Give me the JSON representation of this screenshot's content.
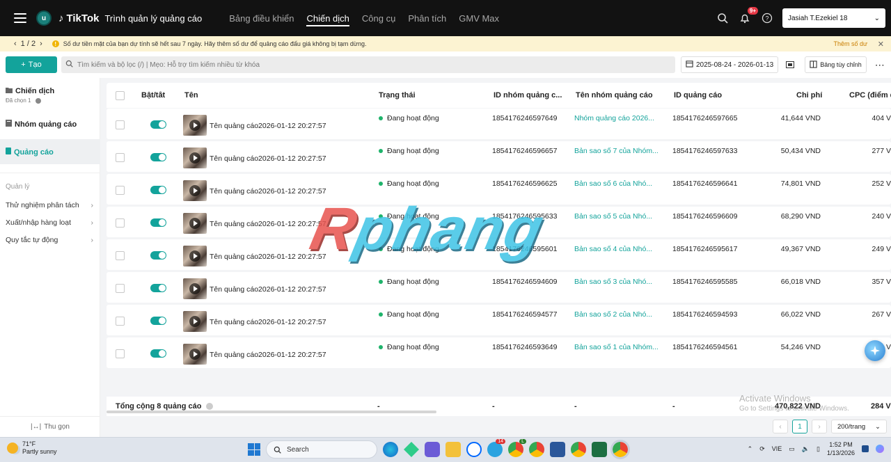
{
  "topbar": {
    "brand": "TikTok",
    "subtitle": "Trình quản lý quảng cáo",
    "avatar_letter": "u",
    "nav": [
      "Bảng điều khiển",
      "Chiến dịch",
      "Công cụ",
      "Phân tích",
      "GMV Max"
    ],
    "active_nav": "Chiến dịch",
    "notif_count": "9+",
    "account_name": "Jasiah T.Ezekiel 18"
  },
  "notice": {
    "pager": "1 / 2",
    "message": "Số dư tiền mặt của bạn dự tính sẽ hết sau 7 ngày. Hãy thêm số dư để quảng cáo đấu giá không bị tạm dừng.",
    "cta": "Thêm số dư"
  },
  "toolbar": {
    "create_label": "Tạo",
    "search_placeholder": "Tìm kiếm và bộ lọc (/) | Mẹo: Hỗ trợ tìm kiếm nhiều từ khóa",
    "date_range": "2025-08-24 - 2026-01-13",
    "custom_table": "Bảng tùy chỉnh"
  },
  "sidebar": {
    "campaign": "Chiến dịch",
    "campaign_sub": "Đã chọn 1",
    "adgroup": "Nhóm quảng cáo",
    "ads": "Quảng cáo",
    "section": "Quản lý",
    "links": [
      "Thử nghiệm phân tách",
      "Xuất/nhập hàng loạt",
      "Quy tắc tự động"
    ],
    "collapse": "Thu gọn"
  },
  "table": {
    "headers": {
      "toggle": "Bật/tắt",
      "name": "Tên",
      "status": "Trạng thái",
      "adgroup_id": "ID nhóm quảng c...",
      "adgroup_name": "Tên nhóm quảng cáo",
      "ad_id": "ID quảng cáo",
      "cost": "Chi phí",
      "cpc": "CPC (điểm đ"
    },
    "rows": [
      {
        "name": "Tên quảng cáo2026-01-12 20:27:57",
        "status": "Đang hoạt động",
        "adgroup_id": "1854176246597649",
        "adgroup_name": "Nhóm quảng cáo 2026...",
        "ad_id": "1854176246597665",
        "cost": "41,644 VND",
        "cpc": "404 V"
      },
      {
        "name": "Tên quảng cáo2026-01-12 20:27:57",
        "status": "Đang hoạt động",
        "adgroup_id": "1854176246596657",
        "adgroup_name": "Bản sao số 7 của Nhóm...",
        "ad_id": "1854176246597633",
        "cost": "50,434 VND",
        "cpc": "277 V"
      },
      {
        "name": "Tên quảng cáo2026-01-12 20:27:57",
        "status": "Đang hoạt động",
        "adgroup_id": "1854176246596625",
        "adgroup_name": "Bản sao số 6 của Nhó...",
        "ad_id": "1854176246596641",
        "cost": "74,801 VND",
        "cpc": "252 V"
      },
      {
        "name": "Tên quảng cáo2026-01-12 20:27:57",
        "status": "Đang hoạt động",
        "adgroup_id": "1854176246595633",
        "adgroup_name": "Bản sao số 5 của Nhó...",
        "ad_id": "1854176246596609",
        "cost": "68,290 VND",
        "cpc": "240 V"
      },
      {
        "name": "Tên quảng cáo2026-01-12 20:27:57",
        "status": "Đang hoạt động",
        "adgroup_id": "1854176246595601",
        "adgroup_name": "Bản sao số 4 của Nhó...",
        "ad_id": "1854176246595617",
        "cost": "49,367 VND",
        "cpc": "249 V"
      },
      {
        "name": "Tên quảng cáo2026-01-12 20:27:57",
        "status": "Đang hoạt động",
        "adgroup_id": "1854176246594609",
        "adgroup_name": "Bản sao số 3 của Nhó...",
        "ad_id": "1854176246595585",
        "cost": "66,018 VND",
        "cpc": "357 V"
      },
      {
        "name": "Tên quảng cáo2026-01-12 20:27:57",
        "status": "Đang hoạt động",
        "adgroup_id": "1854176246594577",
        "adgroup_name": "Bản sao số 2 của Nhó...",
        "ad_id": "1854176246594593",
        "cost": "66,022 VND",
        "cpc": "267 V"
      },
      {
        "name": "Tên quảng cáo2026-01-12 20:27:57",
        "status": "Đang hoạt động",
        "adgroup_id": "1854176246593649",
        "adgroup_name": "Bản sao số 1 của Nhóm...",
        "ad_id": "1854176246594561",
        "cost": "54,246 VND",
        "cpc": "V"
      }
    ],
    "totals": {
      "label": "Tổng cộng 8 quảng cáo",
      "status": "-",
      "adgroup_id": "-",
      "adgroup_name": "-",
      "ad_id": "-",
      "cost": "470,822 VND",
      "cpc": "284 V"
    }
  },
  "pagination": {
    "page": "1",
    "size": "200/trang"
  },
  "watermark": {
    "first": "R",
    "rest": "phang"
  },
  "activate": {
    "title": "Activate Windows",
    "sub": "Go to Settings to activate Windows."
  },
  "taskbar": {
    "temp": "71°F",
    "weather": "Partly sunny",
    "search": "Search",
    "lang": "VIE",
    "time": "1:52 PM",
    "date": "1/13/2026",
    "badge_telegram": "14",
    "badge_line": "L"
  },
  "colors": {
    "accent": "#13a39b",
    "topbar": "#121212",
    "notice": "#fcf3d2",
    "status": "#1fb36b"
  }
}
